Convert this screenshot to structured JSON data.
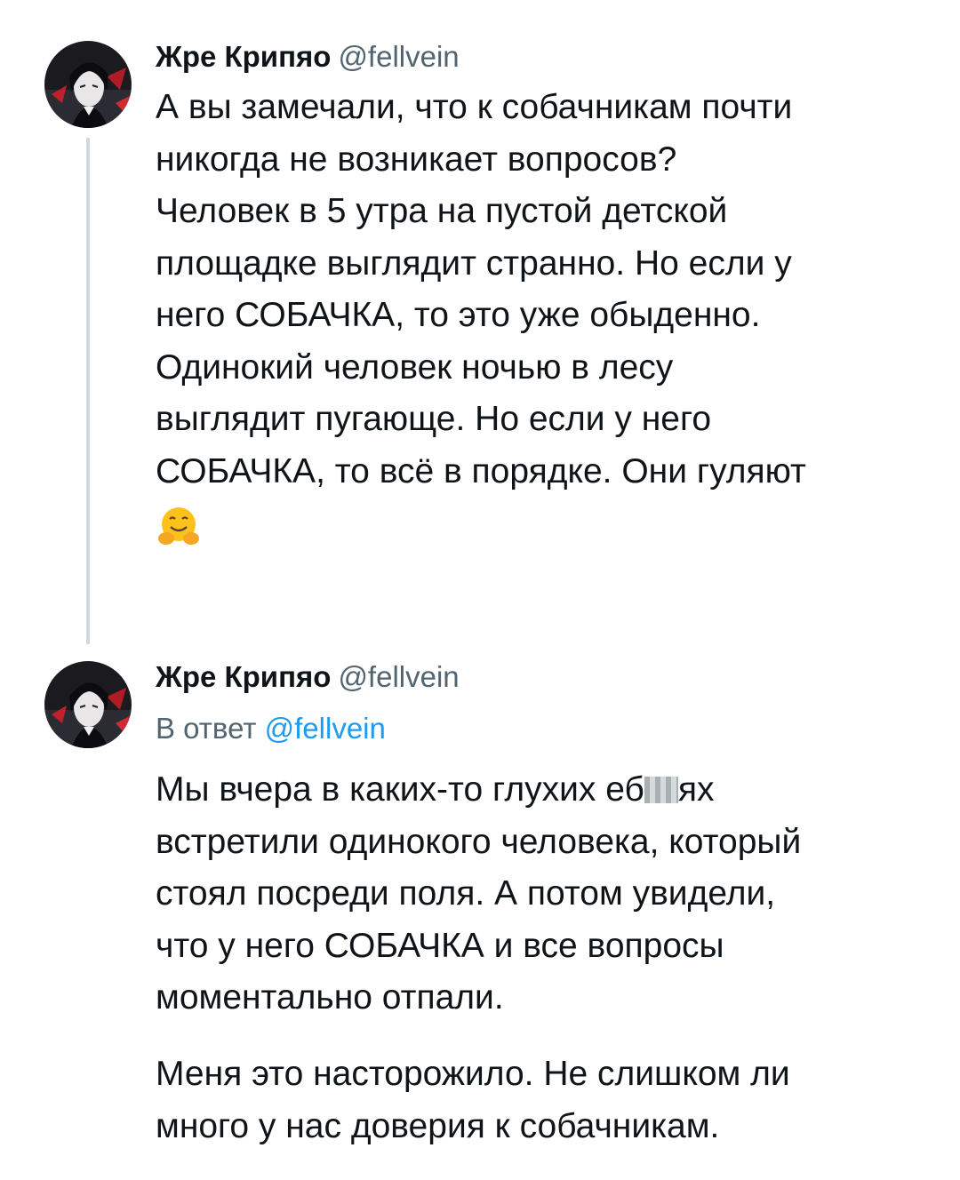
{
  "tweets": [
    {
      "author_name": "Жре Крипяо",
      "author_handle": "@fellvein",
      "text": "А вы замечали, что к собачникам почти\nникогда не возникает вопросов?\nЧеловек в 5 утра на пустой детской\nплощадке выглядит странно. Но если у\nнего СОБАЧКА, то это уже обыденно.\nОдинокий человек ночью в лесу\nвыглядит пугающе. Но если у него\nСОБАЧКА, то всё в порядке. Они гуляют",
      "emoji": "hugging-face-emoji"
    },
    {
      "author_name": "Жре Крипяо",
      "author_handle": "@fellvein",
      "reply_prefix": "В ответ",
      "reply_to": "@fellvein",
      "text_line1_start": "Мы вчера в каких-то глухих еб",
      "text_line1_end": "ях",
      "text_rest": "встретили одинокого человека, который\nстоял посреди поля. А потом увидели,\nчто у него СОБАЧКА и все вопросы\nмоментально отпали.",
      "text_paragraph2": "Меня это насторожило. Не слишком ли\nмного у нас доверия к собачникам."
    }
  ],
  "colors": {
    "text": "#0f1419",
    "secondary": "#536471",
    "link": "#1d9bf0",
    "thread_line": "#cfd9de"
  }
}
